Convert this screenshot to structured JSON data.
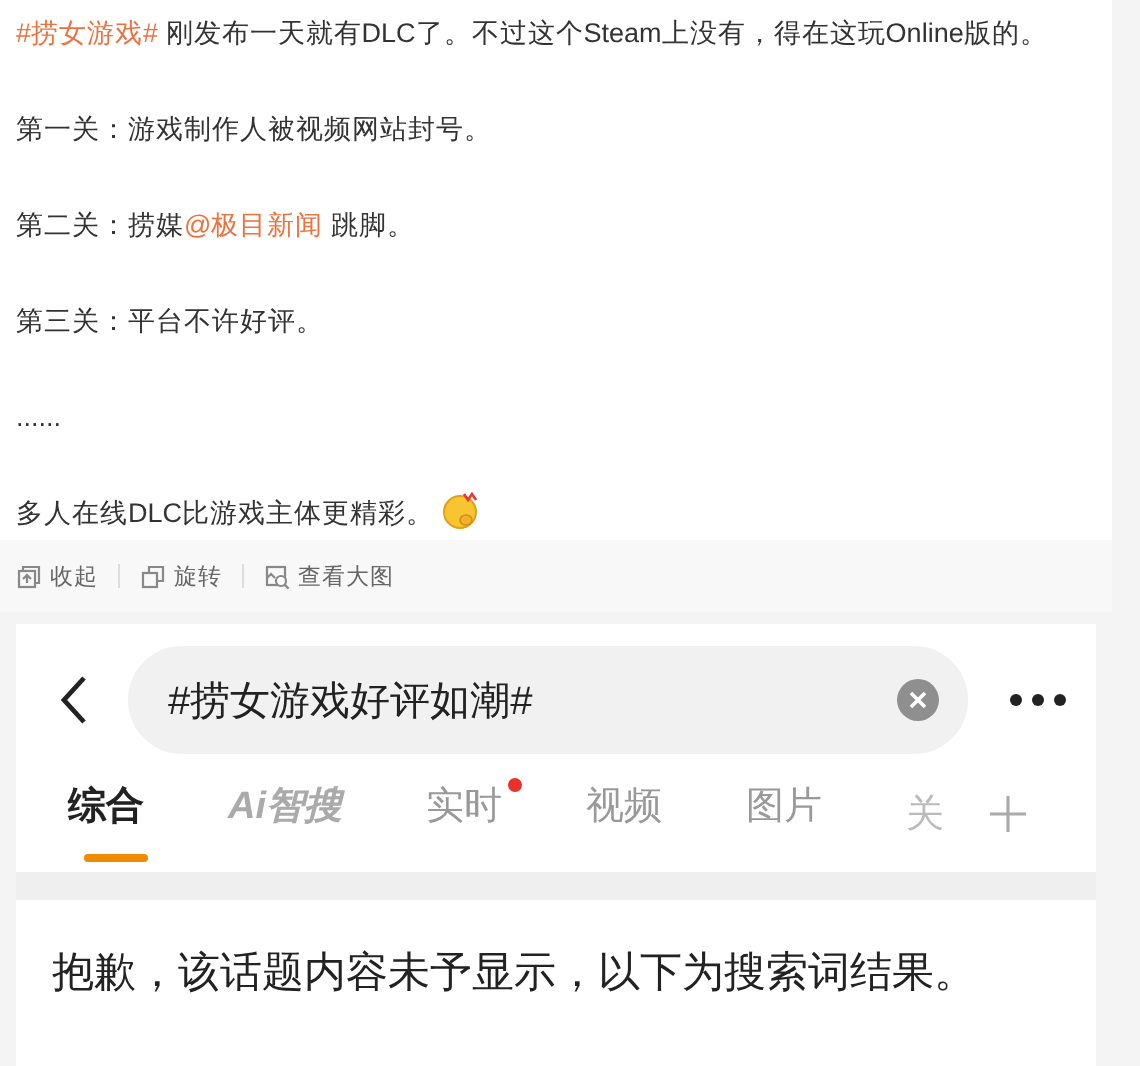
{
  "post": {
    "paragraphs": [
      {
        "parts": [
          {
            "kind": "link",
            "text": "#捞女游戏#"
          },
          {
            "kind": "text",
            "text": " 刚发布一天就有DLC了。不过这个Steam上没有，得在这玩Online版的。"
          }
        ]
      },
      {
        "parts": [
          {
            "kind": "text",
            "text": "第一关：游戏制作人被视频网站封号。"
          }
        ]
      },
      {
        "parts": [
          {
            "kind": "text",
            "text": "第二关：捞媒"
          },
          {
            "kind": "link",
            "text": "@极目新闻"
          },
          {
            "kind": "text",
            "text": " 跳脚。"
          }
        ]
      },
      {
        "parts": [
          {
            "kind": "text",
            "text": "第三关：平台不许好评。"
          }
        ]
      },
      {
        "parts": [
          {
            "kind": "text",
            "text": "......"
          }
        ]
      },
      {
        "parts": [
          {
            "kind": "text",
            "text": "多人在线DLC比游戏主体更精彩。"
          },
          {
            "kind": "emoji"
          }
        ]
      }
    ]
  },
  "image_actions": [
    {
      "kind": "collapse",
      "label": "收起"
    },
    {
      "kind": "rotate",
      "label": "旋转"
    },
    {
      "kind": "zoom",
      "label": "查看大图"
    }
  ],
  "screenshot": {
    "search": {
      "value": "#捞女游戏好评如潮#"
    },
    "tabs": [
      {
        "label": "综合",
        "selected": true,
        "kind": "text",
        "dot": false
      },
      {
        "label": "Ai智搜",
        "selected": false,
        "kind": "logo",
        "dot": false
      },
      {
        "label": "实时",
        "selected": false,
        "kind": "text",
        "dot": true
      },
      {
        "label": "视频",
        "selected": false,
        "kind": "text",
        "dot": false
      },
      {
        "label": "图片",
        "selected": false,
        "kind": "text",
        "dot": false
      },
      {
        "label": "关",
        "selected": false,
        "kind": "cut",
        "dot": false
      }
    ],
    "notice": "抱歉，该话题内容未予显示，以下为搜索词结果。"
  }
}
